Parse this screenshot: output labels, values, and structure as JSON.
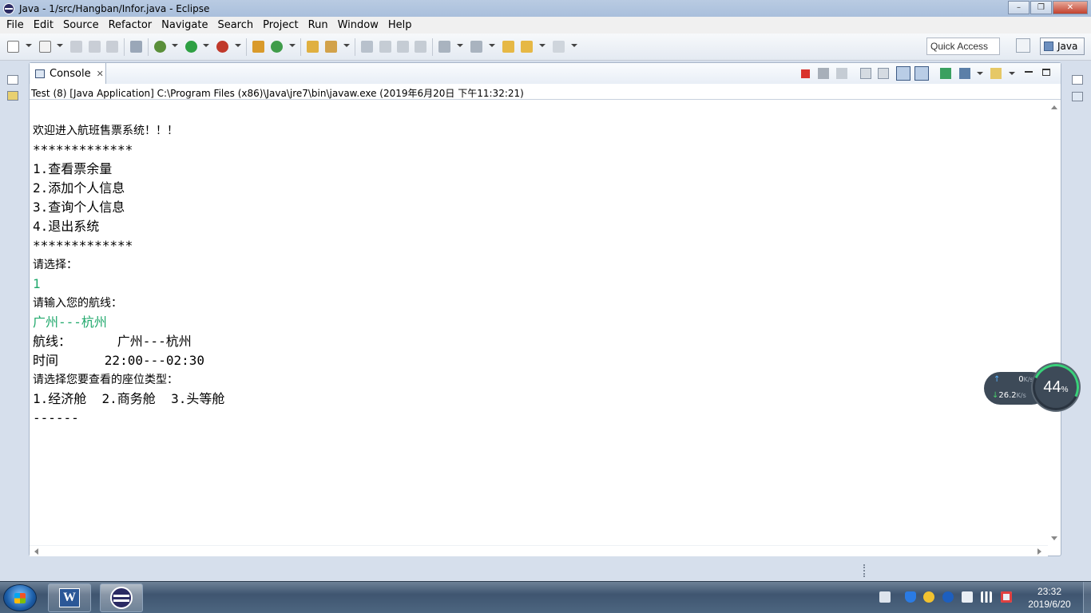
{
  "window": {
    "title": "Java - 1/src/Hangban/Infor.java - Eclipse",
    "min": "–",
    "max": "❐",
    "close": "✕"
  },
  "menu": [
    "File",
    "Edit",
    "Source",
    "Refactor",
    "Navigate",
    "Search",
    "Project",
    "Run",
    "Window",
    "Help"
  ],
  "toolbar": {
    "quick_access": "Quick Access",
    "perspective": "Java"
  },
  "console": {
    "tab_label": "Console",
    "tab_close": "✕",
    "description": "Test (8) [Java Application] C:\\Program Files (x86)\\Java\\jre7\\bin\\javaw.exe (2019年6月20日 下午11:32:21)",
    "lines": [
      {
        "text": "欢迎进入航班售票系统！！！",
        "kind": "small"
      },
      {
        "text": "*************",
        "kind": "out"
      },
      {
        "text": "1.查看票余量",
        "kind": "out"
      },
      {
        "text": "2.添加个人信息",
        "kind": "out"
      },
      {
        "text": "3.查询个人信息",
        "kind": "out"
      },
      {
        "text": "4.退出系统",
        "kind": "out"
      },
      {
        "text": "*************",
        "kind": "out"
      },
      {
        "text": "请选择：",
        "kind": "small"
      },
      {
        "text": "1",
        "kind": "input"
      },
      {
        "text": "请输入您的航线：",
        "kind": "small"
      },
      {
        "text": "广州---杭州",
        "kind": "input"
      },
      {
        "text": "航线：      广州---杭州",
        "kind": "out"
      },
      {
        "text": "时间      22:00---02:30",
        "kind": "out"
      },
      {
        "text": "请选择您要查看的座位类型：",
        "kind": "small"
      },
      {
        "text": "1.经济舱  2.商务舱  3.头等舱",
        "kind": "out"
      },
      {
        "text": "------",
        "kind": "out"
      }
    ]
  },
  "netmon": {
    "up_value": "0",
    "up_unit": "K/s",
    "down_value": "26.2",
    "down_unit": "K/s",
    "percent": "44",
    "percent_unit": "%"
  },
  "taskbar": {
    "word_letter": "W",
    "clock_time": "23:32",
    "clock_date": "2019/6/20"
  },
  "colors": {
    "input_text": "#1fa86b",
    "title_bar": "#b9cbe2",
    "close_button": "#c2412e"
  }
}
